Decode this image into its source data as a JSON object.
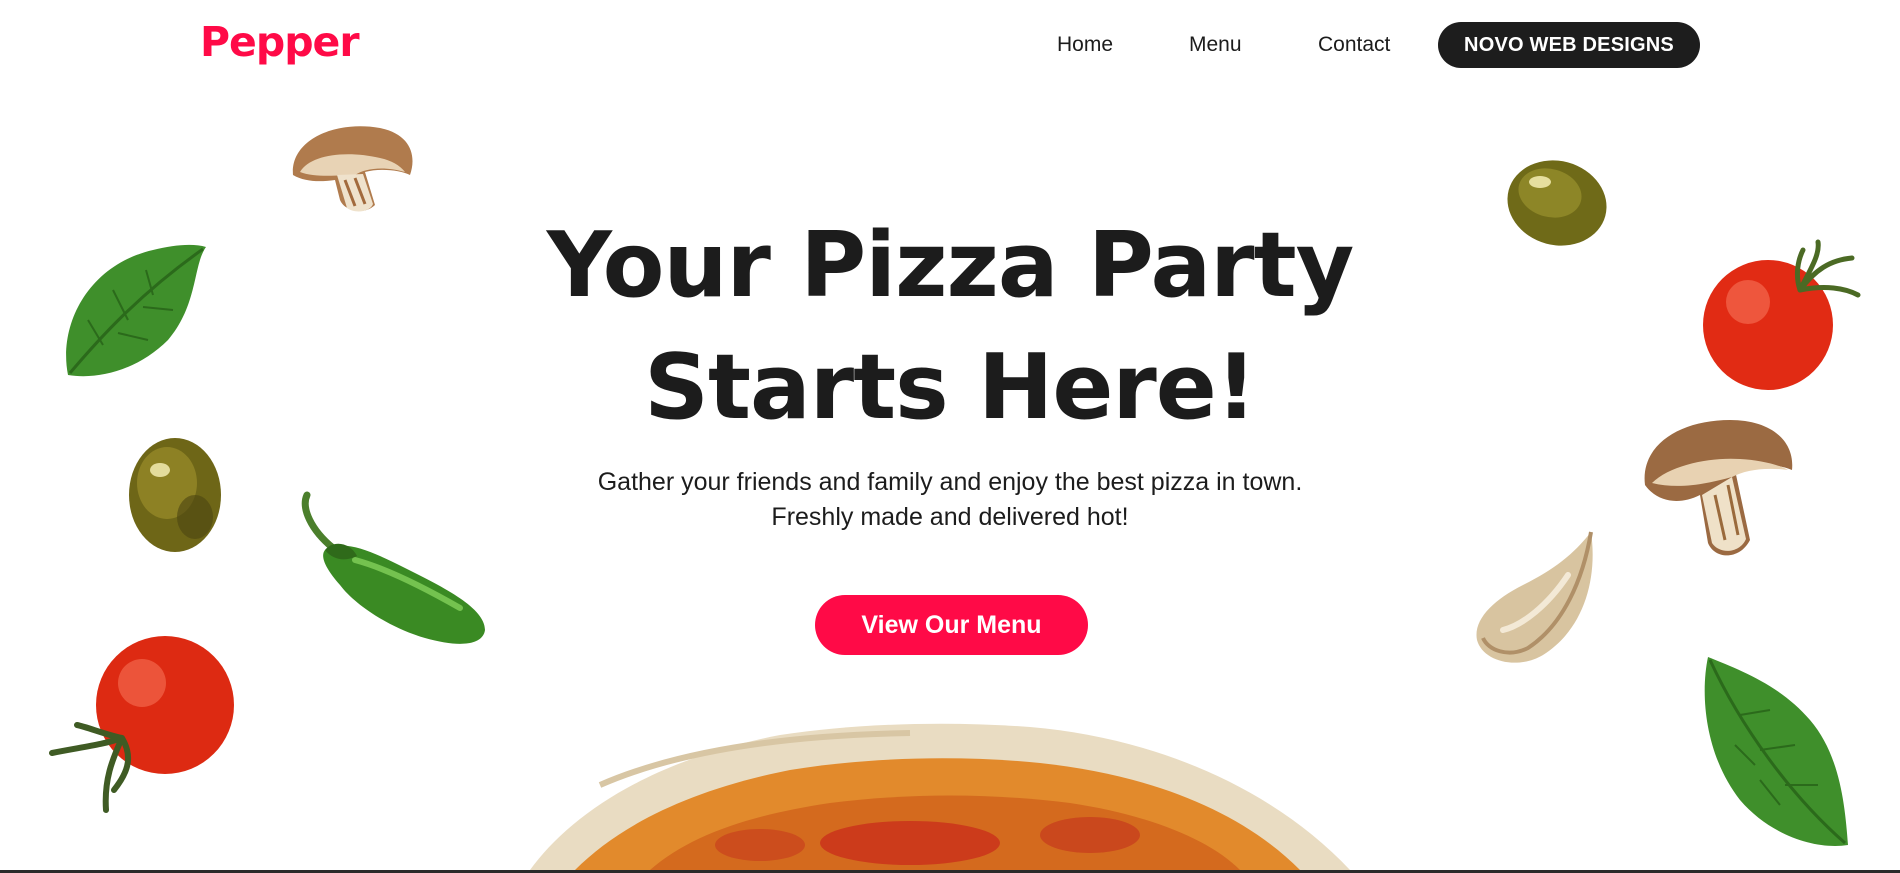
{
  "header": {
    "logo": "Pepper",
    "nav": {
      "home": "Home",
      "menu": "Menu",
      "contact": "Contact"
    },
    "cta_label": "NOVO WEB DESIGNS"
  },
  "hero": {
    "title_line1": "Your Pizza Party",
    "title_line2": "Starts Here!",
    "subtitle_line1": "Gather your friends and family and enjoy the best pizza in town.",
    "subtitle_line2": "Freshly made and delivered hot!",
    "button_label": "View Our Menu"
  },
  "decorations": {
    "left": [
      "mushroom-image",
      "basil-leaf-image",
      "olive-image",
      "jalapeno-image",
      "tomato-image"
    ],
    "right": [
      "olive-image",
      "tomato-image",
      "mushroom-image",
      "garlic-image",
      "basil-leaf-image"
    ],
    "bottom": "pizza-image"
  },
  "colors": {
    "brand": "#ff0a47",
    "dark": "#1d1d1d",
    "text": "#1c1c1c",
    "background": "#ffffff"
  }
}
